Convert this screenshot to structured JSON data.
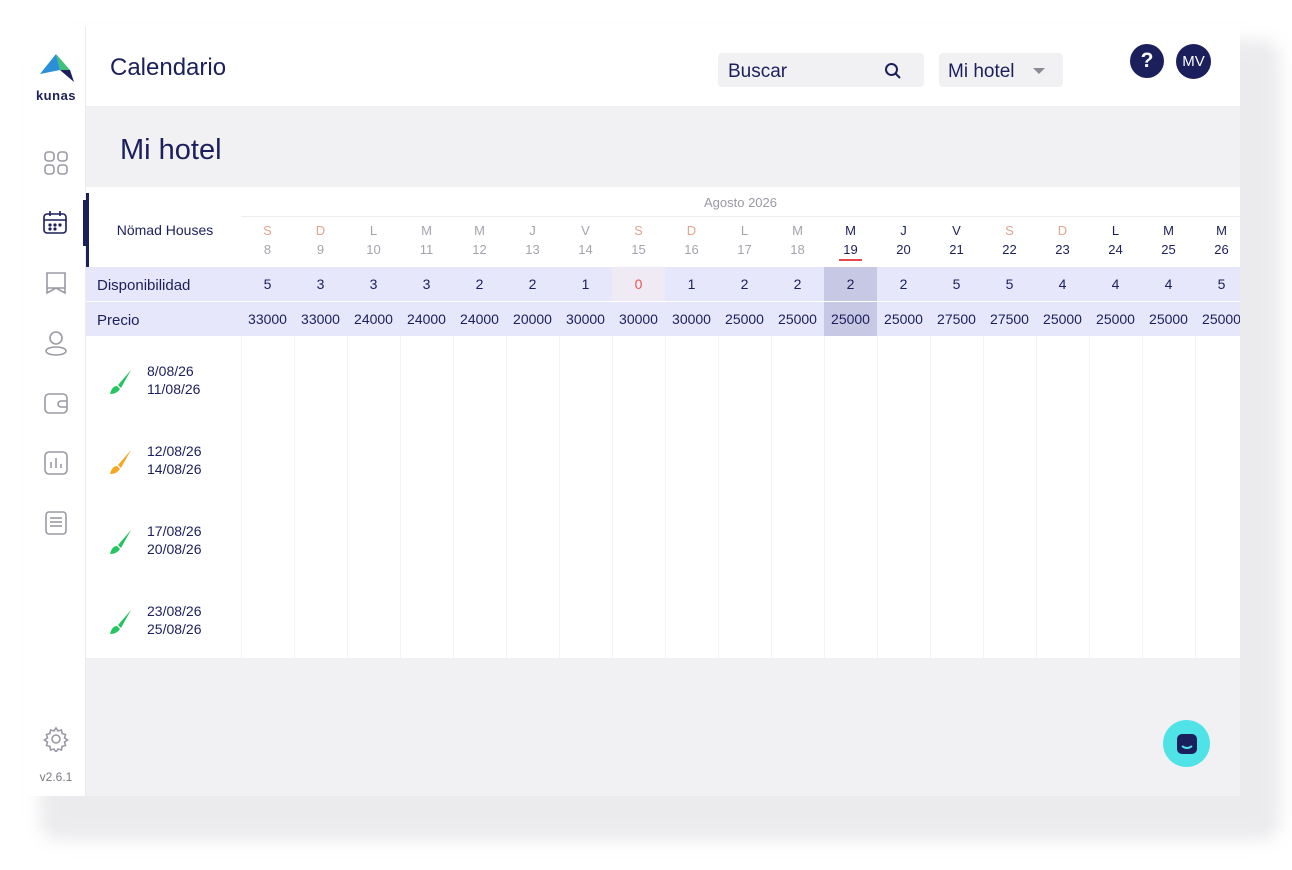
{
  "brand": {
    "logo_text": "kunas",
    "version": "v2.6.1",
    "colors": {
      "navy": "#1b1f5c",
      "green": "#22c55e",
      "orange": "#f5a623",
      "chat": "#4fe3e7"
    }
  },
  "sidebar": {
    "items": [
      {
        "icon": "grid-icon"
      },
      {
        "icon": "calendar-icon",
        "active": true
      },
      {
        "icon": "bookmark-icon"
      },
      {
        "icon": "user-icon"
      },
      {
        "icon": "wallet-icon"
      },
      {
        "icon": "chart-icon"
      },
      {
        "icon": "document-icon"
      }
    ],
    "settings_icon": "gear-icon"
  },
  "header": {
    "title": "Calendario",
    "search_label": "Buscar",
    "hotel_select": "Mi hotel",
    "help": "?",
    "avatar": "MV"
  },
  "page": {
    "title": "Mi hotel"
  },
  "calendar": {
    "property": "Nömad Houses",
    "month": "Agosto 2026",
    "days": [
      {
        "letter": "S",
        "num": "8",
        "avail": "5",
        "price": "33000"
      },
      {
        "letter": "D",
        "num": "9",
        "avail": "3",
        "price": "33000"
      },
      {
        "letter": "L",
        "num": "10",
        "avail": "3",
        "price": "24000"
      },
      {
        "letter": "M",
        "num": "11",
        "avail": "3",
        "price": "24000"
      },
      {
        "letter": "M",
        "num": "12",
        "avail": "2",
        "price": "24000"
      },
      {
        "letter": "J",
        "num": "13",
        "avail": "2",
        "price": "20000"
      },
      {
        "letter": "V",
        "num": "14",
        "avail": "1",
        "price": "30000"
      },
      {
        "letter": "S",
        "num": "15",
        "avail": "0",
        "price": "30000"
      },
      {
        "letter": "D",
        "num": "16",
        "avail": "1",
        "price": "30000"
      },
      {
        "letter": "L",
        "num": "17",
        "avail": "2",
        "price": "25000"
      },
      {
        "letter": "M",
        "num": "18",
        "avail": "2",
        "price": "25000"
      },
      {
        "letter": "M",
        "num": "19",
        "avail": "2",
        "price": "25000"
      },
      {
        "letter": "J",
        "num": "20",
        "avail": "2",
        "price": "25000"
      },
      {
        "letter": "V",
        "num": "21",
        "avail": "5",
        "price": "27500"
      },
      {
        "letter": "S",
        "num": "22",
        "avail": "5",
        "price": "27500"
      },
      {
        "letter": "D",
        "num": "23",
        "avail": "4",
        "price": "25000"
      },
      {
        "letter": "L",
        "num": "24",
        "avail": "4",
        "price": "25000"
      },
      {
        "letter": "M",
        "num": "25",
        "avail": "4",
        "price": "25000"
      },
      {
        "letter": "M",
        "num": "26",
        "avail": "5",
        "price": "25000"
      }
    ],
    "today_day": "19",
    "rows": {
      "availability_label": "Disponibilidad",
      "price_label": "Precio"
    },
    "bookings": [
      {
        "start": "8/08/26",
        "end": "11/08/26",
        "status_color": "#22c55e"
      },
      {
        "start": "12/08/26",
        "end": "14/08/26",
        "status_color": "#f5a623"
      },
      {
        "start": "17/08/26",
        "end": "20/08/26",
        "status_color": "#22c55e"
      },
      {
        "start": "23/08/26",
        "end": "25/08/26",
        "status_color": "#22c55e"
      }
    ]
  },
  "chat": {
    "icon": "chat-icon"
  }
}
